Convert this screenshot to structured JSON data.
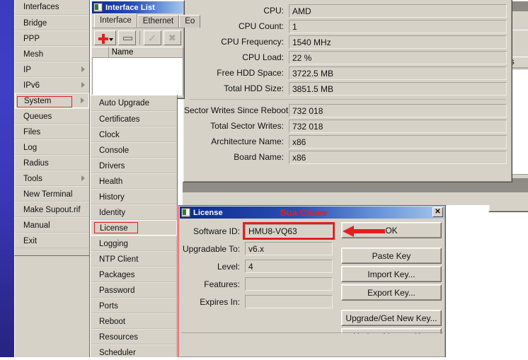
{
  "desktop": {
    "background_color": "#ffffff",
    "accent_color": "#3b3bbf"
  },
  "start_menu": {
    "items": [
      {
        "label": "Interfaces",
        "has_submenu": false,
        "selected": false
      },
      {
        "label": "Bridge",
        "has_submenu": false,
        "selected": false
      },
      {
        "label": "PPP",
        "has_submenu": false,
        "selected": false
      },
      {
        "label": "Mesh",
        "has_submenu": false,
        "selected": false
      },
      {
        "label": "IP",
        "has_submenu": true,
        "selected": false
      },
      {
        "label": "IPv6",
        "has_submenu": true,
        "selected": false
      },
      {
        "label": "System",
        "has_submenu": true,
        "selected": true
      },
      {
        "label": "Queues",
        "has_submenu": false,
        "selected": false
      },
      {
        "label": "Files",
        "has_submenu": false,
        "selected": false
      },
      {
        "label": "Log",
        "has_submenu": false,
        "selected": false
      },
      {
        "label": "Radius",
        "has_submenu": false,
        "selected": false
      },
      {
        "label": "Tools",
        "has_submenu": true,
        "selected": false
      },
      {
        "label": "New Terminal",
        "has_submenu": false,
        "selected": false
      },
      {
        "label": "Make Supout.rif",
        "has_submenu": false,
        "selected": false
      },
      {
        "label": "Manual",
        "has_submenu": false,
        "selected": false
      },
      {
        "label": "Exit",
        "has_submenu": false,
        "selected": false
      }
    ]
  },
  "system_submenu": {
    "items": [
      {
        "label": "Auto Upgrade",
        "selected": false
      },
      {
        "label": "Certificates",
        "selected": false
      },
      {
        "label": "Clock",
        "selected": false
      },
      {
        "label": "Console",
        "selected": false
      },
      {
        "label": "Drivers",
        "selected": false
      },
      {
        "label": "Health",
        "selected": false
      },
      {
        "label": "History",
        "selected": false
      },
      {
        "label": "Identity",
        "selected": false
      },
      {
        "label": "License",
        "selected": true
      },
      {
        "label": "Logging",
        "selected": false
      },
      {
        "label": "NTP Client",
        "selected": false
      },
      {
        "label": "Packages",
        "selected": false
      },
      {
        "label": "Password",
        "selected": false
      },
      {
        "label": "Ports",
        "selected": false
      },
      {
        "label": "Reboot",
        "selected": false
      },
      {
        "label": "Resources",
        "selected": false
      },
      {
        "label": "Scheduler",
        "selected": false
      }
    ]
  },
  "interface_list_window": {
    "title": "Interface List",
    "tabs": [
      {
        "label": "Interface",
        "active": true
      },
      {
        "label": "Ethernet",
        "active": false
      },
      {
        "label": "Eo",
        "active": false
      }
    ],
    "toolbar": [
      {
        "name": "add-button",
        "glyph": "plus"
      },
      {
        "name": "remove-button",
        "glyph": "minus"
      },
      {
        "name": "enable-button",
        "glyph": "check"
      },
      {
        "name": "disable-button",
        "glyph": "cross"
      }
    ],
    "columns": [
      "",
      "Name"
    ]
  },
  "resources_window": {
    "rows": [
      {
        "label": "CPU:",
        "value": "AMD"
      },
      {
        "label": "CPU Count:",
        "value": "1"
      },
      {
        "label": "CPU Frequency:",
        "value": "1540 MHz"
      },
      {
        "label": "CPU Load:",
        "value": "22 %"
      },
      {
        "label": "Free HDD Space:",
        "value": "3722.5 MB"
      },
      {
        "label": "Total HDD Size:",
        "value": "3851.5 MB"
      }
    ],
    "rows2": [
      {
        "label": "Sector Writes Since Reboot:",
        "value": "732 018"
      },
      {
        "label": "Total Sector Writes:",
        "value": "732 018"
      },
      {
        "label": "Architecture Name:",
        "value": "x86"
      },
      {
        "label": "Board Name:",
        "value": "x86"
      }
    ]
  },
  "background_window": {
    "column_header": "Drops"
  },
  "license_dialog": {
    "title": "License",
    "annotation": "Sua Chave",
    "close_label": "✕",
    "fields": [
      {
        "label": "Software ID:",
        "value": "HMU8-VQ63",
        "highlighted": true
      },
      {
        "label": "Upgradable To:",
        "value": "v6.x",
        "highlighted": false
      },
      {
        "label": "Level:",
        "value": "4",
        "highlighted": false
      },
      {
        "label": "Features:",
        "value": "",
        "highlighted": false
      },
      {
        "label": "Expires In:",
        "value": "",
        "highlighted": false
      }
    ],
    "buttons": [
      {
        "label": "OK",
        "name": "ok-button"
      },
      {
        "label": "Paste Key",
        "name": "paste-key-button"
      },
      {
        "label": "Import Key...",
        "name": "import-key-button"
      },
      {
        "label": "Export Key...",
        "name": "export-key-button"
      },
      {
        "label": "Upgrade/Get New Key...",
        "name": "upgrade-get-new-key-button"
      },
      {
        "label": "Update License Key",
        "name": "update-license-key-button"
      }
    ]
  }
}
